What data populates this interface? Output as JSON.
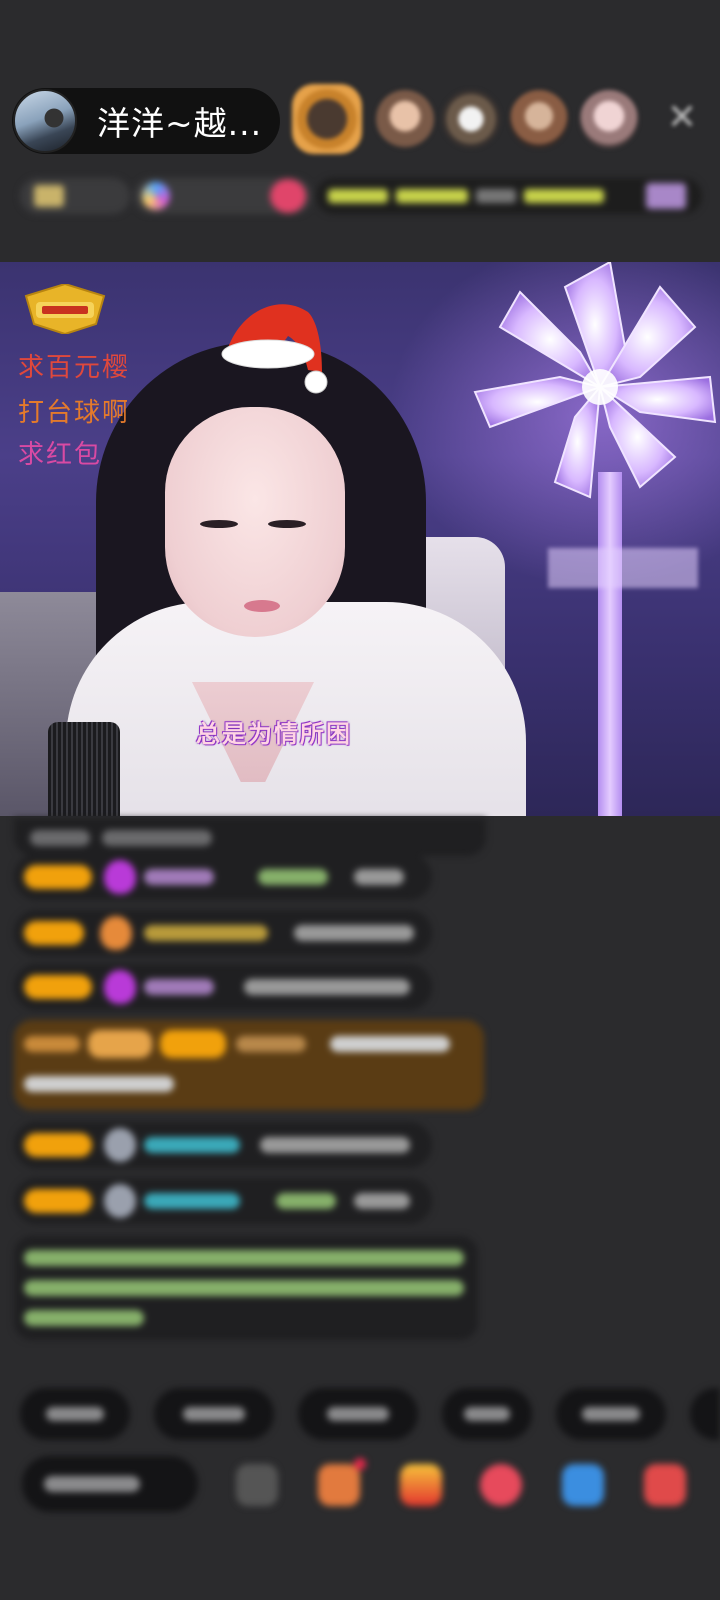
{
  "header": {
    "host_name": "洋洋~越...",
    "close_symbol": "✕"
  },
  "stream": {
    "top_notes": [
      "求百元樱",
      "打台球啊",
      "求红包"
    ],
    "subtitle": "总是为情所困"
  },
  "colors": {
    "background": "#2b2b2d",
    "level_badge": "#f1a10c",
    "bubble": "#1f1f21",
    "subtitle_outline": "#a13ad3"
  },
  "icons": [
    "close-icon",
    "gem-icon",
    "avatar-icon",
    "gift-icon",
    "emoji-icon"
  ]
}
